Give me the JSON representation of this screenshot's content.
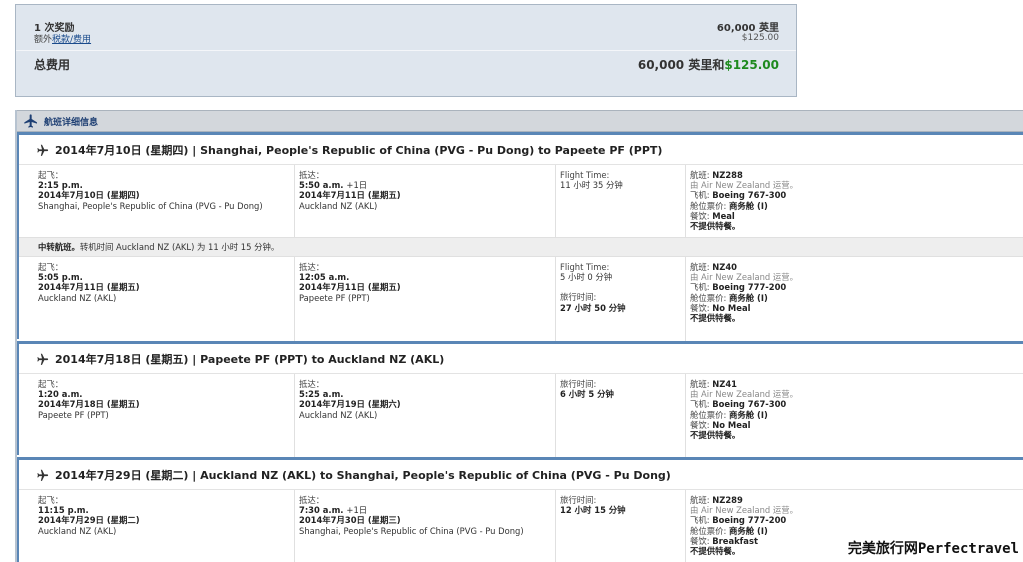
{
  "summary": {
    "award_label": "1 次奖励",
    "award_miles": "60,000 英里",
    "tax_prefix": "额外",
    "tax_link": "税款/费用",
    "tax_amount": "$125.00",
    "total_label": "总费用",
    "total_miles": "60,000 英里和",
    "total_money": "$125.00"
  },
  "panel": {
    "title": "航班详细信息"
  },
  "labels": {
    "depart": "起飞：",
    "arrive": "抵达：",
    "flight_time": "Flight Time:",
    "travel_time": "旅行时间:",
    "flight": "航班:",
    "aircraft": "飞机:",
    "cabin": "舱位票价:",
    "meal": "餐饮:",
    "special": "不提供特餐。",
    "plus_day": "+1日"
  },
  "legs": [
    {
      "title": "2014年7月10日 (星期四) | Shanghai, People's Republic of China (PVG - Pu Dong) to Papeete PF (PPT)",
      "segments": [
        {
          "dep_time": "2:15 p.m.",
          "dep_date": "2014年7月10日 (星期四)",
          "dep_place": "Shanghai, People's Republic of China (PVG - Pu Dong)",
          "arr_time": "5:50 a.m.",
          "arr_date": "2014年7月11日 (星期五)",
          "arr_place": "Auckland NZ (AKL)",
          "flight_time": "11 小时 35 分钟",
          "flight_no": "NZ288",
          "operated": "由 Air New Zealand 运营。",
          "aircraft": "Boeing 767-300",
          "cabin": "商务舱 (I)",
          "meal": "Meal"
        },
        {
          "connection_bold": "中转航班。",
          "connection_text": "转机时间 Auckland NZ (AKL) 为 11 小时 15 分钟。",
          "dep_time": "5:05 p.m.",
          "dep_date": "2014年7月11日 (星期五)",
          "dep_place": "Auckland NZ (AKL)",
          "arr_time": "12:05 a.m.",
          "arr_date": "2014年7月11日 (星期五)",
          "arr_place": "Papeete PF (PPT)",
          "flight_time": "5 小时 0 分钟",
          "travel_time": "27 小时 50 分钟",
          "flight_no": "NZ40",
          "operated": "由 Air New Zealand 运营。",
          "aircraft": "Boeing 777-200",
          "cabin": "商务舱 (I)",
          "meal": "No Meal"
        }
      ]
    },
    {
      "title": "2014年7月18日 (星期五) | Papeete PF (PPT) to Auckland NZ (AKL)",
      "segments": [
        {
          "dep_time": "1:20 a.m.",
          "dep_date": "2014年7月18日 (星期五)",
          "dep_place": "Papeete PF (PPT)",
          "arr_time": "5:25 a.m.",
          "arr_date": "2014年7月19日 (星期六)",
          "arr_place": "Auckland NZ (AKL)",
          "travel_time": "6 小时 5 分钟",
          "flight_no": "NZ41",
          "operated": "由 Air New Zealand 运营。",
          "aircraft": "Boeing 767-300",
          "cabin": "商务舱 (I)",
          "meal": "No Meal"
        }
      ]
    },
    {
      "title": "2014年7月29日 (星期二) | Auckland NZ (AKL) to Shanghai, People's Republic of China (PVG - Pu Dong)",
      "segments": [
        {
          "dep_time": "11:15 p.m.",
          "dep_date": "2014年7月29日 (星期二)",
          "dep_place": "Auckland NZ (AKL)",
          "arr_time": "7:30 a.m.",
          "arr_date": "2014年7月30日 (星期三)",
          "arr_place": "Shanghai, People's Republic of China (PVG - Pu Dong)",
          "travel_time": "12 小时 15 分钟",
          "flight_no": "NZ289",
          "operated": "由 Air New Zealand 运营。",
          "aircraft": "Boeing 777-200",
          "cabin": "商务舱 (I)",
          "meal": "Breakfast"
        }
      ]
    }
  ],
  "watermark": "完美旅行网Perfectravel"
}
